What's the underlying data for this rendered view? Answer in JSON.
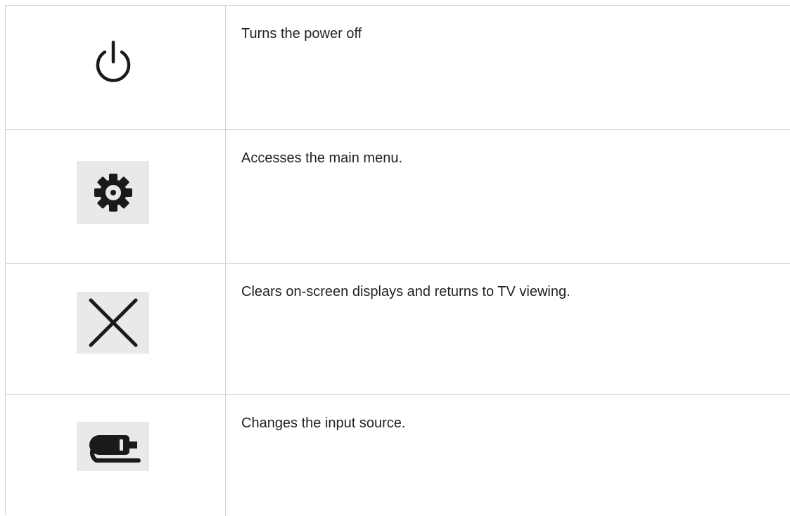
{
  "rows": [
    {
      "icon": "power-icon",
      "description": "Turns the power off"
    },
    {
      "icon": "gear-icon",
      "description": "Accesses the main menu."
    },
    {
      "icon": "close-icon",
      "description": "Clears on-screen displays and returns to TV viewing."
    },
    {
      "icon": "input-source-icon",
      "description": "Changes the input source."
    }
  ],
  "colors": {
    "border": "#d0d0d0",
    "icon_bg": "#e9e9e9",
    "icon": "#1a1a1a",
    "text": "#222222"
  }
}
